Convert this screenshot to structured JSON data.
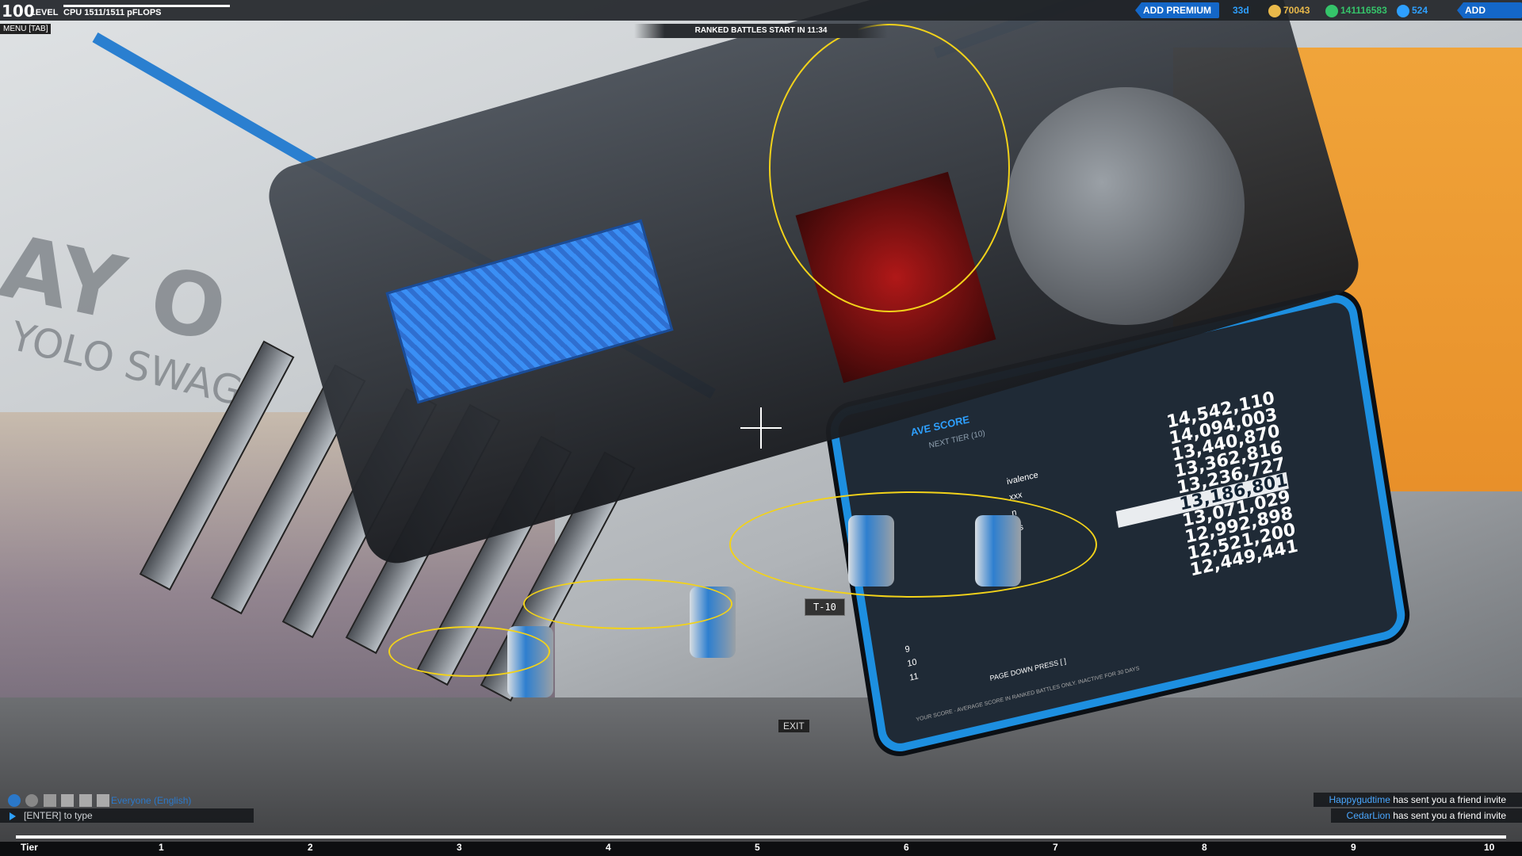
{
  "hud": {
    "level_value": "100",
    "level_label": "LEVEL",
    "cpu_text": "CPU 1511/1511 pFLOPS",
    "cpu_fraction": 1.0,
    "menu_label": "MENU [TAB]",
    "ranked_banner": "RANKED BATTLES START IN 11:34",
    "premium": {
      "label": "ADD PREMIUM",
      "days": "33d"
    },
    "tech_points": "70043",
    "robits": "141116583",
    "cosmetic_credits": "524",
    "add_funds_label": "ADD FUNDS"
  },
  "leaderboard": {
    "title": "AVE SCORE",
    "subtitle": "NEXT TIER (10)",
    "scores": [
      "14,542,110",
      "14,094,003",
      "13,440,870",
      "13,362,816",
      "13,236,727",
      "13,186,801",
      "13,071,029",
      "12,992,898",
      "12,521,200",
      "12,449,441"
    ],
    "highlight_index": 5,
    "partial_names": [
      "ivalence",
      "xxx",
      "n",
      "es"
    ],
    "ranks": [
      "9",
      "10",
      "11"
    ],
    "page_hint": "PAGE DOWN PRESS [ ]",
    "footer": "YOUR SCORE - AVERAGE SCORE IN RANKED BATTLES ONLY. INACTIVE FOR 30 DAYS",
    "wall_text_big": "AY O",
    "wall_text_small": "YOLO SWAG"
  },
  "robot": {
    "tag": "T-10",
    "exit_label": "EXIT"
  },
  "chat": {
    "channel": "Everyone (English)",
    "input_placeholder": "[ENTER] to type",
    "notifications": [
      {
        "who": "Happygudtime",
        "text": " has sent you a friend invite"
      },
      {
        "who": "CedarLion",
        "text": " has sent you a friend invite"
      }
    ]
  },
  "tier_bar": {
    "start_label": "Tier",
    "marks": [
      "1",
      "2",
      "3",
      "4",
      "5",
      "6",
      "7",
      "8",
      "9",
      "10"
    ]
  },
  "colors": {
    "accent_blue": "#1467c8",
    "orbit_yellow": "#f2d21a",
    "tech_gold": "#e9b94a",
    "robits_green": "#35c46a",
    "cc_blue": "#2ea0ff"
  }
}
